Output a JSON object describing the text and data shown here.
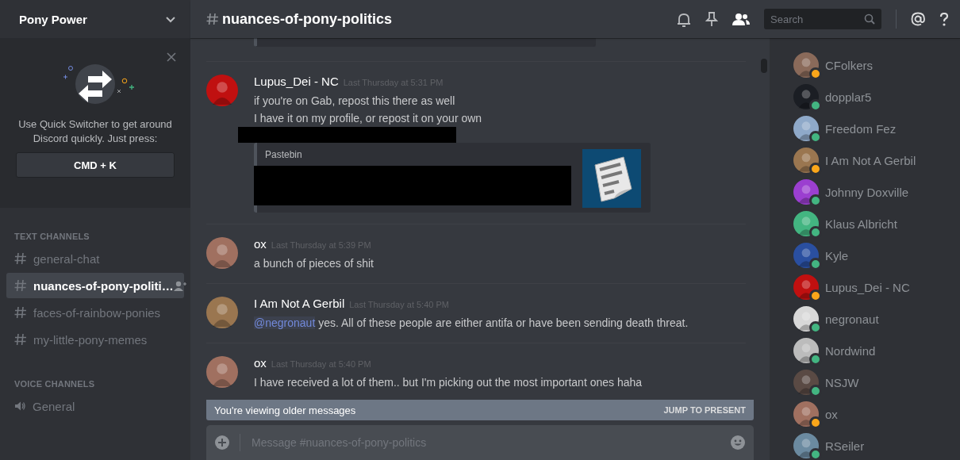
{
  "server": {
    "name": "Pony Power"
  },
  "quick_switcher": {
    "text": "Use Quick Switcher to get around Discord quickly. Just press:",
    "shortcut": "CMD + K"
  },
  "channel_groups": [
    {
      "title": "TEXT CHANNELS",
      "kind": "text",
      "channels": [
        {
          "name": "general-chat",
          "selected": false
        },
        {
          "name": "nuances-of-pony-politi…",
          "selected": true
        },
        {
          "name": "faces-of-rainbow-ponies",
          "selected": false
        },
        {
          "name": "my-little-pony-memes",
          "selected": false
        }
      ]
    },
    {
      "title": "VOICE CHANNELS",
      "kind": "voice",
      "channels": [
        {
          "name": "General",
          "selected": false
        }
      ]
    }
  ],
  "header": {
    "channel": "nuances-of-pony-politics",
    "search_placeholder": "Search"
  },
  "messages": [
    {
      "author": "Lupus_Dei - NC",
      "time": "Last Thursday at 5:31 PM",
      "lines": [
        {
          "text": "if you're on Gab, repost this there as well"
        },
        {
          "text": "I have it on my profile, or repost it on your own"
        }
      ],
      "embed": {
        "provider": "Pastebin"
      }
    },
    {
      "author": "ox",
      "time": "Last Thursday at 5:39 PM",
      "lines": [
        {
          "text": "a bunch of pieces of shit"
        }
      ]
    },
    {
      "author": "I Am Not A Gerbil",
      "time": "Last Thursday at 5:40 PM",
      "lines": [
        {
          "mention": "@negronaut",
          "text": "yes. All of these people are either antifa or have been sending death threat."
        }
      ]
    },
    {
      "author": "ox",
      "time": "Last Thursday at 5:40 PM",
      "lines": [
        {
          "text": "I have received a lot of them.. but I'm picking out the most important ones haha"
        }
      ]
    }
  ],
  "older_banner": {
    "text": "You're viewing older messages",
    "action": "JUMP TO PRESENT"
  },
  "composer": {
    "placeholder": "Message #nuances-of-pony-politics"
  },
  "members": [
    {
      "name": "CFolkers",
      "color": "#faa61a"
    },
    {
      "name": "dopplar5",
      "color": "#43b581"
    },
    {
      "name": "Freedom Fez",
      "color": "#43b581"
    },
    {
      "name": "I Am Not A Gerbil",
      "color": "#faa61a"
    },
    {
      "name": "Johnny Doxville",
      "color": "#43b581"
    },
    {
      "name": "Klaus Albricht",
      "color": "#43b581"
    },
    {
      "name": "Kyle",
      "color": "#43b581"
    },
    {
      "name": "Lupus_Dei - NC",
      "color": "#faa61a"
    },
    {
      "name": "negronaut",
      "color": "#43b581"
    },
    {
      "name": "Nordwind",
      "color": "#43b581"
    },
    {
      "name": "NSJW",
      "color": "#43b581"
    },
    {
      "name": "ox",
      "color": "#faa61a"
    },
    {
      "name": "RSeiler",
      "color": "#43b581"
    }
  ]
}
